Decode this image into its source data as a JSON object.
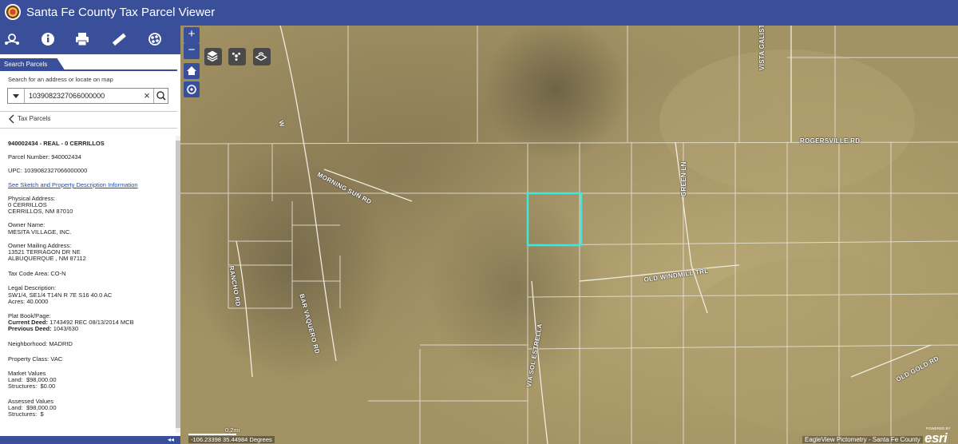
{
  "header": {
    "title": "Santa Fe County Tax Parcel Viewer"
  },
  "toolbar": {
    "items": [
      {
        "icon": "route-icon"
      },
      {
        "icon": "info-icon"
      },
      {
        "icon": "print-icon"
      },
      {
        "icon": "measure-icon"
      },
      {
        "icon": "basemap-icon"
      }
    ]
  },
  "search": {
    "tab_label": "Search Parcels",
    "hint": "Search for an address or locate on map",
    "value": "1039082327066000000",
    "placeholder": ""
  },
  "results": {
    "header": "Tax Parcels"
  },
  "parcel": {
    "heading": "940002434 - REAL - 0 CERRILLOS",
    "parcel_number_label": "Parcel Number:",
    "parcel_number": "940002434",
    "upc_label": "UPC:",
    "upc": "1039082327066000000",
    "sketch_link": "See Sketch and Property Description Information",
    "physical_address_label": "Physical Address:",
    "physical_address_line1": "0 CERRILLOS",
    "physical_address_line2": "CERRILLOS, NM 87010",
    "owner_name_label": "Owner Name:",
    "owner_name": "MESITA VILLAGE, INC.",
    "owner_mailing_label": "Owner Mailing Address:",
    "owner_mailing_line1": "13521 TERRAGON DR NE",
    "owner_mailing_line2": "ALBUQUERQUE , NM 87112",
    "tax_code_label": "Tax Code Area:",
    "tax_code": "CO-N",
    "legal_label": "Legal Description:",
    "legal": "SW1/4, SE1/4 T14N R 7E S16 40.0 AC",
    "acres_label": "Acres:",
    "acres": "40.0000",
    "plat_label": "Plat Book/Page:",
    "current_deed_label": "Current Deed:",
    "current_deed": "1743492 REC 08/13/2014 MCB",
    "previous_deed_label": "Previous Deed:",
    "previous_deed": "1043/630",
    "neighborhood_label": "Neighborhood:",
    "neighborhood": "MADRID",
    "property_class_label": "Property Class:",
    "property_class": "VAC",
    "market_label": "Market Values",
    "market_land_label": "Land:",
    "market_land": "$98,000.00",
    "market_structures_label": "Structures:",
    "market_structures": "$0.00",
    "assessed_label": "Assessed Values",
    "assessed_land_label": "Land:",
    "assessed_land": "$98,000.00",
    "assessed_structures_label": "Structures:",
    "assessed_structures": "$"
  },
  "map": {
    "zoom_in": "+",
    "zoom_out": "−",
    "roads": {
      "rogersville": "ROGERSVILLE RD",
      "vista_galisteo": "VISTA GALISTEO",
      "morning_sun": "MORNING SUN RD",
      "green": "GREEN LN",
      "old_windmill": "OLD WINDMILL TRL",
      "rancho": "RANCHO RD",
      "bar_vaquero": "BAR VAQUERO RD",
      "vía_sol": "VIA SOL ESTRELLA",
      "old_gold": "OLD GOLD RD",
      "upper_left": "W"
    },
    "coordinates": "-106.23398 35.44984 Degrees",
    "scale": "0.2mi",
    "attribution": "EagleView Pictometry - Santa Fe County",
    "esri_powered": "POWERED BY",
    "esri": "esri",
    "highlight_color": "#3ee8e0"
  },
  "footer": {
    "collapse": "◂◂"
  }
}
